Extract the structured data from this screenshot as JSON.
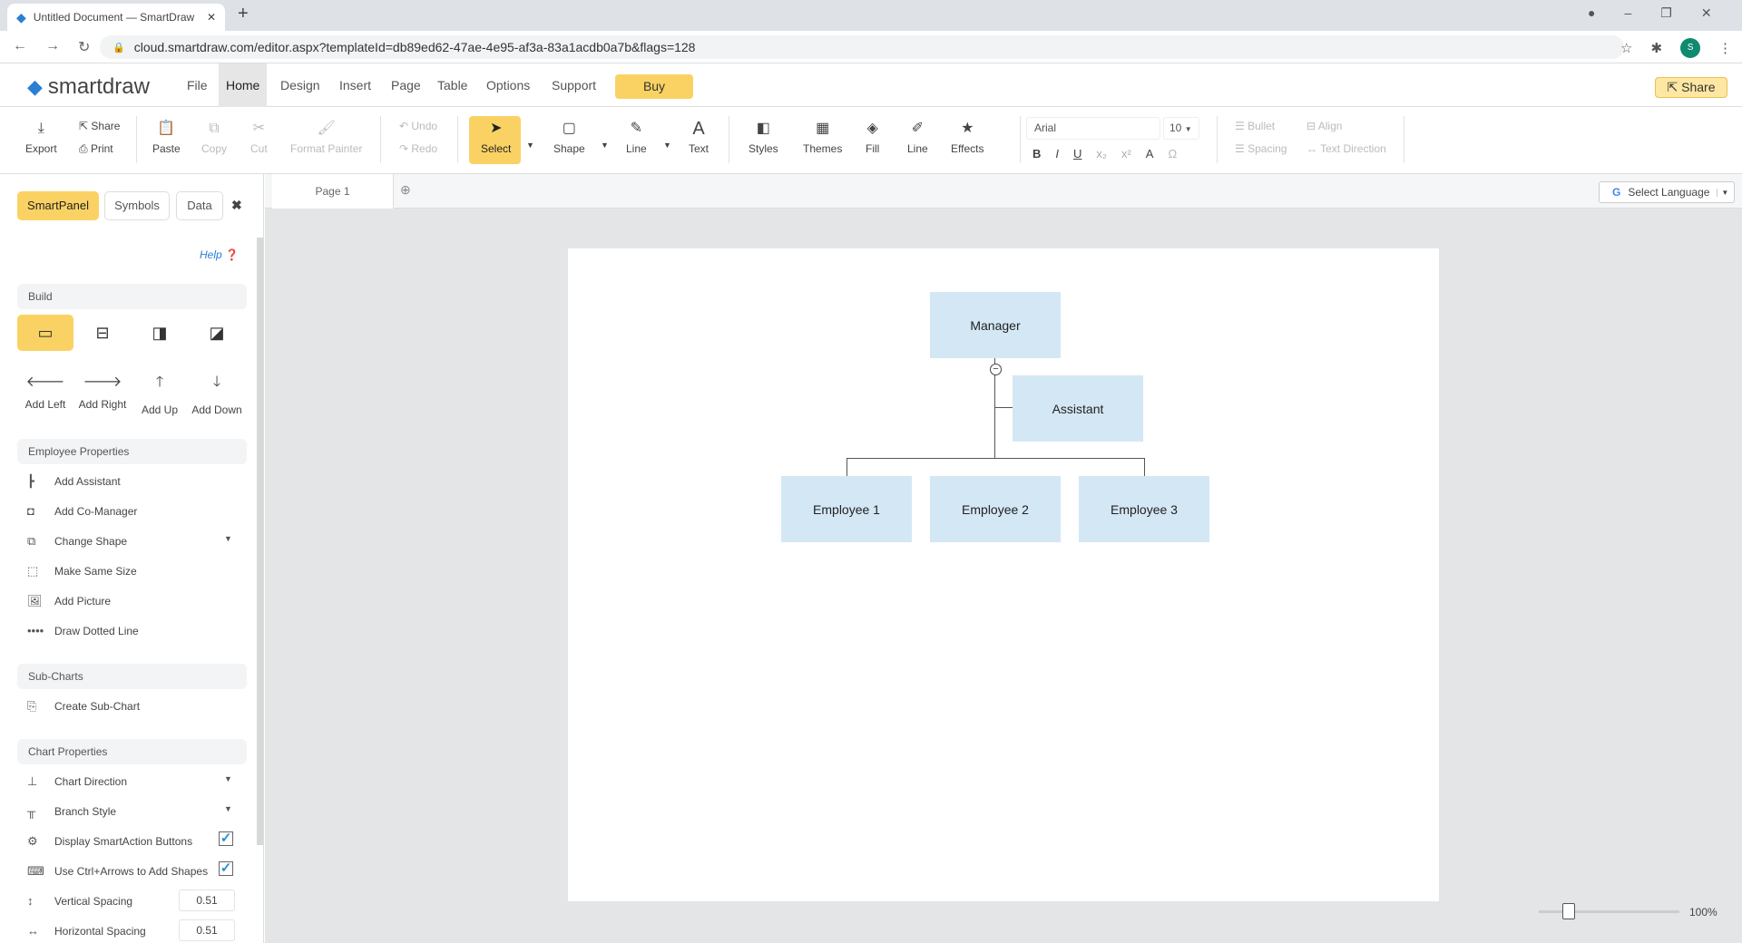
{
  "browser": {
    "tab_title": "Untitled Document — SmartDraw",
    "url": "cloud.smartdraw.com/editor.aspx?templateId=db89ed62-47ae-4e95-af3a-83a1acdb0a7b&flags=128",
    "profile_initial": "S"
  },
  "app": {
    "logo": "smartdraw",
    "menu": [
      "File",
      "Home",
      "Design",
      "Insert",
      "Page",
      "Table",
      "Options",
      "Support"
    ],
    "active_menu": "Home",
    "buy_label": "Buy",
    "share_label": "Share"
  },
  "toolbar": {
    "export": "Export",
    "share": "Share",
    "print": "Print",
    "paste": "Paste",
    "copy": "Copy",
    "cut": "Cut",
    "format_painter": "Format Painter",
    "undo": "Undo",
    "redo": "Redo",
    "select": "Select",
    "shape": "Shape",
    "line": "Line",
    "text": "Text",
    "styles": "Styles",
    "themes": "Themes",
    "fill": "Fill",
    "line2": "Line",
    "effects": "Effects",
    "font": "Arial",
    "font_size": "10",
    "bullet": "Bullet",
    "align": "Align",
    "spacing": "Spacing",
    "text_direction": "Text Direction"
  },
  "sidebar": {
    "tabs": [
      "SmartPanel",
      "Symbols",
      "Data"
    ],
    "help": "Help",
    "build_header": "Build",
    "arrows": [
      "Add Left",
      "Add Right",
      "Add Up",
      "Add Down"
    ],
    "employee_header": "Employee Properties",
    "employee_items": [
      "Add Assistant",
      "Add Co-Manager",
      "Change Shape",
      "Make Same Size",
      "Add Picture",
      "Draw Dotted Line"
    ],
    "subcharts_header": "Sub-Charts",
    "create_subchart": "Create Sub-Chart",
    "chart_header": "Chart Properties",
    "chart_direction": "Chart Direction",
    "branch_style": "Branch Style",
    "display_smartaction": "Display SmartAction Buttons",
    "display_smartaction_checked": true,
    "ctrl_arrows": "Use Ctrl+Arrows to Add Shapes",
    "ctrl_arrows_checked": true,
    "vertical_spacing": "Vertical Spacing",
    "vertical_spacing_value": "0.51",
    "horizontal_spacing": "Horizontal Spacing",
    "horizontal_spacing_value": "0.51"
  },
  "pages": {
    "tab": "Page 1",
    "language": "Select Language"
  },
  "diagram": {
    "manager": "Manager",
    "assistant": "Assistant",
    "employees": [
      "Employee 1",
      "Employee 2",
      "Employee 3"
    ],
    "box_color": "#d4e7f4"
  },
  "zoom": {
    "label": "100%",
    "value": 100
  },
  "colors": {
    "accent": "#fad264"
  }
}
